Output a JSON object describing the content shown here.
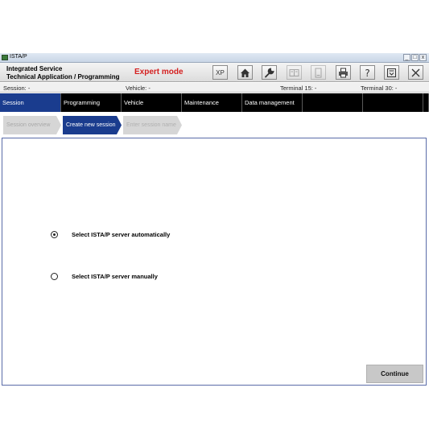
{
  "window": {
    "title": "ISTA/P",
    "controls": {
      "minimize": "_",
      "maximize": "□",
      "close": "x"
    }
  },
  "header": {
    "app_name_line1": "Integrated Service",
    "app_name_line2": "Technical Application / Programming",
    "mode": "Expert mode",
    "mode_color": "#d42020",
    "toolbar": [
      {
        "icon": "xp-icon",
        "label": "XP",
        "enabled": true
      },
      {
        "icon": "home-icon",
        "enabled": true
      },
      {
        "icon": "wrench-icon",
        "enabled": true
      },
      {
        "icon": "compare-icon",
        "enabled": false
      },
      {
        "icon": "document-icon",
        "enabled": false
      },
      {
        "icon": "printer-icon",
        "enabled": true
      },
      {
        "icon": "help-icon",
        "enabled": true
      },
      {
        "icon": "minimize-window-icon",
        "enabled": true
      },
      {
        "icon": "close-icon",
        "enabled": true
      }
    ]
  },
  "info": {
    "session": "Session:  -",
    "vehicle": "Vehicle:  -",
    "terminal15": "Terminal 15:  -",
    "terminal30": "Terminal 30:  -"
  },
  "nav": {
    "tabs": [
      "Session",
      "Programming",
      "Vehicle",
      "Maintenance",
      "Data management",
      "",
      "",
      ""
    ],
    "active_index": 0,
    "active_color": "#1a3c8e"
  },
  "subnav": {
    "tabs": [
      {
        "label": "Session overview",
        "state": "done"
      },
      {
        "label": "Create new session",
        "state": "active"
      },
      {
        "label": "Enter session name",
        "state": "pending"
      }
    ]
  },
  "main": {
    "options": [
      {
        "label": "Select ISTA/P server automatically",
        "checked": true
      },
      {
        "label": "Select ISTA/P server manually",
        "checked": false
      }
    ],
    "continue_label": "Continue"
  }
}
